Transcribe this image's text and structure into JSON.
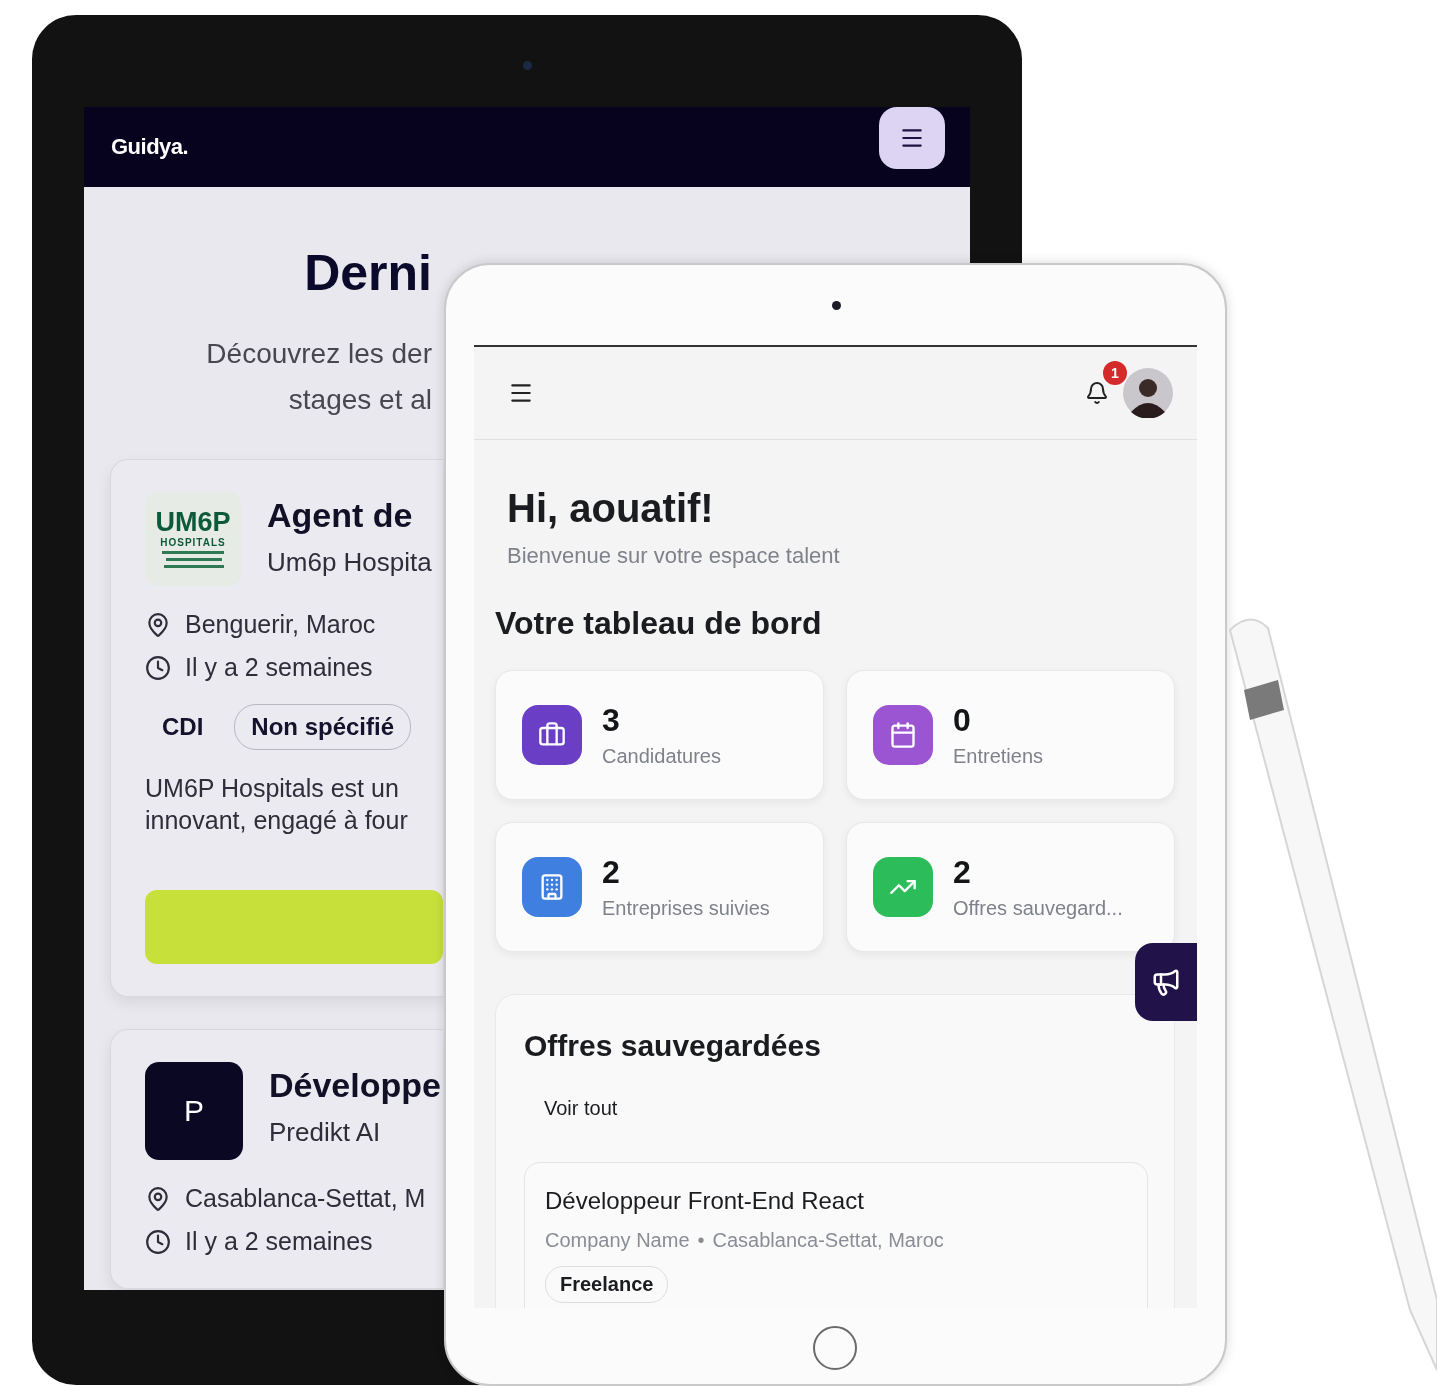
{
  "back_tablet": {
    "logo": "Guidya.",
    "heading": "Derni",
    "subtitle_lines": [
      "Découvrez les der",
      "stages et al"
    ],
    "offers": [
      {
        "logo": {
          "kind": "um6p",
          "title": "UM6P",
          "subtitle": "HOSPITALS"
        },
        "title": "Agent de",
        "company": "Um6p Hospita",
        "location": "Benguerir, Maroc",
        "posted": "Il y a 2 semaines",
        "tags": [
          {
            "label": "CDI",
            "outlined": false
          },
          {
            "label": "Non spécifié",
            "outlined": true
          }
        ],
        "description_lines": [
          "UM6P Hospitals est un",
          "innovant, engagé à four"
        ],
        "has_button": true
      },
      {
        "logo": {
          "kind": "letter",
          "title": "P"
        },
        "title": "Développe",
        "company": "Predikt AI",
        "location": "Casablanca-Settat, M",
        "posted": "Il y a 2 semaines"
      }
    ]
  },
  "front_tablet": {
    "notification_count": "1",
    "greeting": "Hi, aouatif!",
    "welcome": "Bienvenue sur votre espace talent",
    "dashboard_title": "Votre tableau de bord",
    "stats": [
      {
        "value": "3",
        "label": "Candidatures",
        "color": "#6a3fc6"
      },
      {
        "value": "0",
        "label": "Entretiens",
        "color": "#9b55d3"
      },
      {
        "value": "2",
        "label": "Entreprises suivies",
        "color": "#3f7fe0"
      },
      {
        "value": "2",
        "label": "Offres sauvegard...",
        "color": "#2cbd5a"
      }
    ],
    "saved_offers": {
      "title": "Offres sauvegardées",
      "see_all": "Voir tout",
      "items": [
        {
          "title": "Développeur Front-End React",
          "company": "Company Name",
          "separator": "•",
          "location": "Casablanca-Settat, Maroc",
          "tag": "Freelance"
        }
      ]
    }
  }
}
